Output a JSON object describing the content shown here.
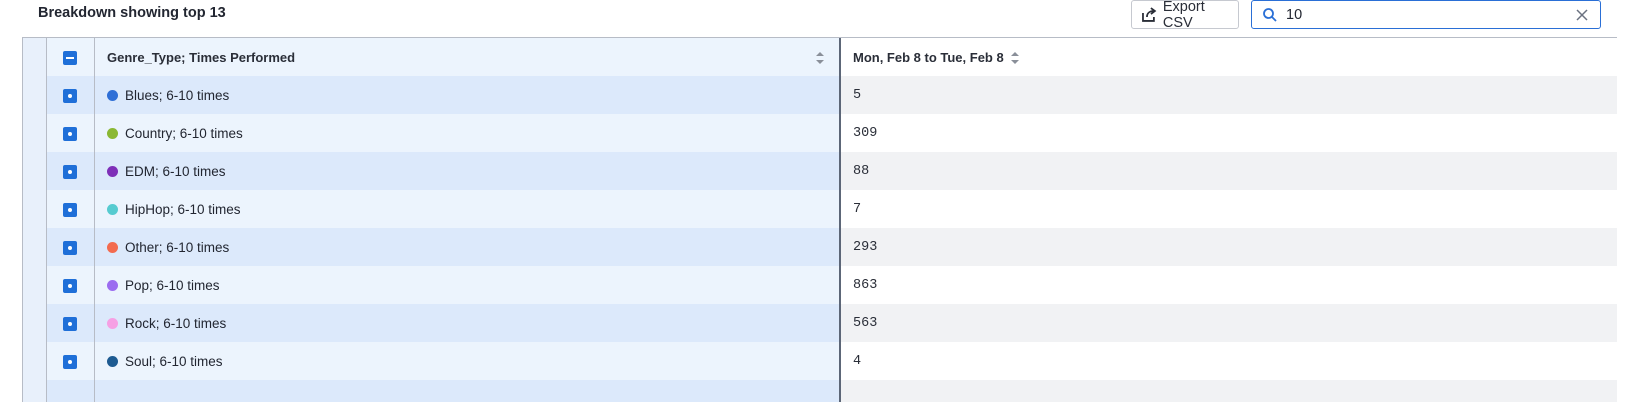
{
  "header": {
    "title": "Breakdown showing top 13",
    "export_label": "Export CSV",
    "search_value": "10"
  },
  "table": {
    "col_label_header": "Genre_Type; Times Performed",
    "col_value_header": "Mon, Feb 8 to Tue, Feb 8",
    "rows": [
      {
        "label": "Blues; 6-10 times",
        "value": "5",
        "color": "#2f6fd6"
      },
      {
        "label": "Country; 6-10 times",
        "value": "309",
        "color": "#8ab833"
      },
      {
        "label": "EDM; 6-10 times",
        "value": "88",
        "color": "#7e2fb8"
      },
      {
        "label": "HipHop; 6-10 times",
        "value": "7",
        "color": "#56cbd0"
      },
      {
        "label": "Other; 6-10 times",
        "value": "293",
        "color": "#f36b4f"
      },
      {
        "label": "Pop; 6-10 times",
        "value": "863",
        "color": "#9b6cf0"
      },
      {
        "label": "Rock; 6-10 times",
        "value": "563",
        "color": "#f6a0e4"
      },
      {
        "label": "Soul; 6-10 times",
        "value": "4",
        "color": "#1d5a91"
      }
    ]
  },
  "icons": {
    "export": "export-icon",
    "search": "search-icon",
    "clear": "close-icon",
    "sort": "sort-icon",
    "checkbox": "checkbox-icon"
  }
}
